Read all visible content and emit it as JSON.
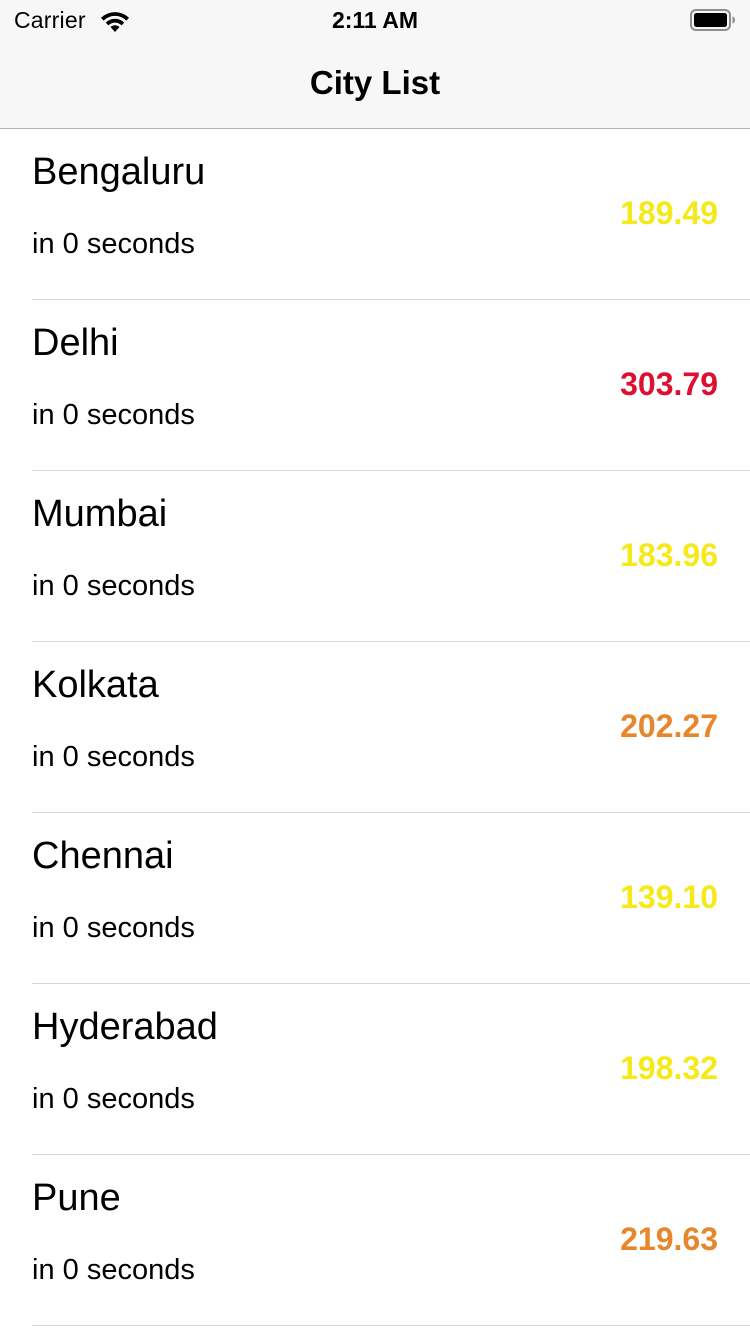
{
  "status_bar": {
    "carrier": "Carrier",
    "time": "2:11 AM",
    "wifi_icon": "wifi-icon",
    "battery_icon": "battery-icon"
  },
  "nav": {
    "title": "City List"
  },
  "colors": {
    "yellow": "#f5e91a",
    "red": "#de1030",
    "orange": "#e8862c"
  },
  "cities": [
    {
      "name": "Bengaluru",
      "updated": "in 0 seconds",
      "value": "189.49",
      "color": "#f5e91a"
    },
    {
      "name": "Delhi",
      "updated": "in 0 seconds",
      "value": "303.79",
      "color": "#de1030"
    },
    {
      "name": "Mumbai",
      "updated": "in 0 seconds",
      "value": "183.96",
      "color": "#f5e91a"
    },
    {
      "name": "Kolkata",
      "updated": "in 0 seconds",
      "value": "202.27",
      "color": "#e8862c"
    },
    {
      "name": "Chennai",
      "updated": "in 0 seconds",
      "value": "139.10",
      "color": "#f5e91a"
    },
    {
      "name": "Hyderabad",
      "updated": "in 0 seconds",
      "value": "198.32",
      "color": "#f5e91a"
    },
    {
      "name": "Pune",
      "updated": "in 0 seconds",
      "value": "219.63",
      "color": "#e8862c"
    }
  ]
}
